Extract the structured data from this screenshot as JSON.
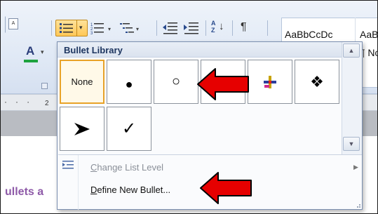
{
  "ribbon": {
    "styles": [
      "AaBbCcDc",
      "AaB"
    ],
    "style_second_row": "¶ No",
    "font_color_letter": "A",
    "sort_label": "A",
    "sort_label2": "Z",
    "pilcrow": "¶"
  },
  "ruler": {
    "marks": "· · ·",
    "number": "2"
  },
  "document": {
    "heading": "ullets a"
  },
  "bullet_library": {
    "title": "Bullet Library",
    "items": [
      {
        "label": "None",
        "icon": "none",
        "selected": true
      },
      {
        "glyph": "●",
        "icon": "filled-circle-bullet"
      },
      {
        "glyph": "○",
        "icon": "hollow-circle-bullet"
      },
      {
        "glyph": "",
        "icon": "hidden-bullet"
      },
      {
        "glyph": "",
        "icon": "colored-cross-bullet"
      },
      {
        "glyph": "❖",
        "icon": "diamond-cluster-bullet"
      },
      {
        "glyph": "➤",
        "icon": "arrowhead-bullet"
      },
      {
        "glyph": "✓",
        "icon": "checkmark-bullet"
      }
    ]
  },
  "menu": {
    "change_list_level": {
      "prefix": "C",
      "rest": "hange List Level",
      "enabled": false
    },
    "define_new_bullet": {
      "prefix": "D",
      "rest": "efine New Bullet...",
      "enabled": true
    }
  },
  "colors": {
    "annotation_arrow": "#e60000",
    "selection_border": "#e8a227",
    "accent_heading": "#8e5aa8"
  }
}
